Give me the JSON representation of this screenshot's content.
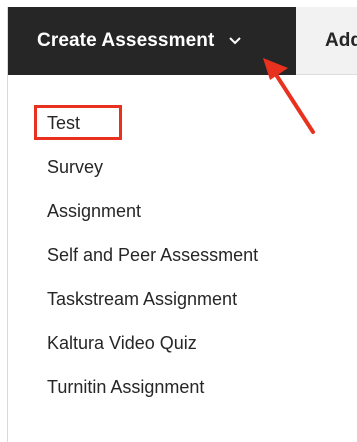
{
  "toolbar": {
    "create_label": "Create Assessment",
    "next_tab_label": "Add Assessment"
  },
  "menu": {
    "items": [
      {
        "label": "Test"
      },
      {
        "label": "Survey"
      },
      {
        "label": "Assignment"
      },
      {
        "label": "Self and Peer Assessment"
      },
      {
        "label": "Taskstream Assignment"
      },
      {
        "label": "Kaltura Video Quiz"
      },
      {
        "label": "Turnitin Assignment"
      }
    ]
  },
  "icons": {
    "dropdown": "chevron-down-icon",
    "callout": "red-arrow-icon"
  },
  "colors": {
    "toolbar_bg": "#262626",
    "highlight": "#e8321f"
  }
}
